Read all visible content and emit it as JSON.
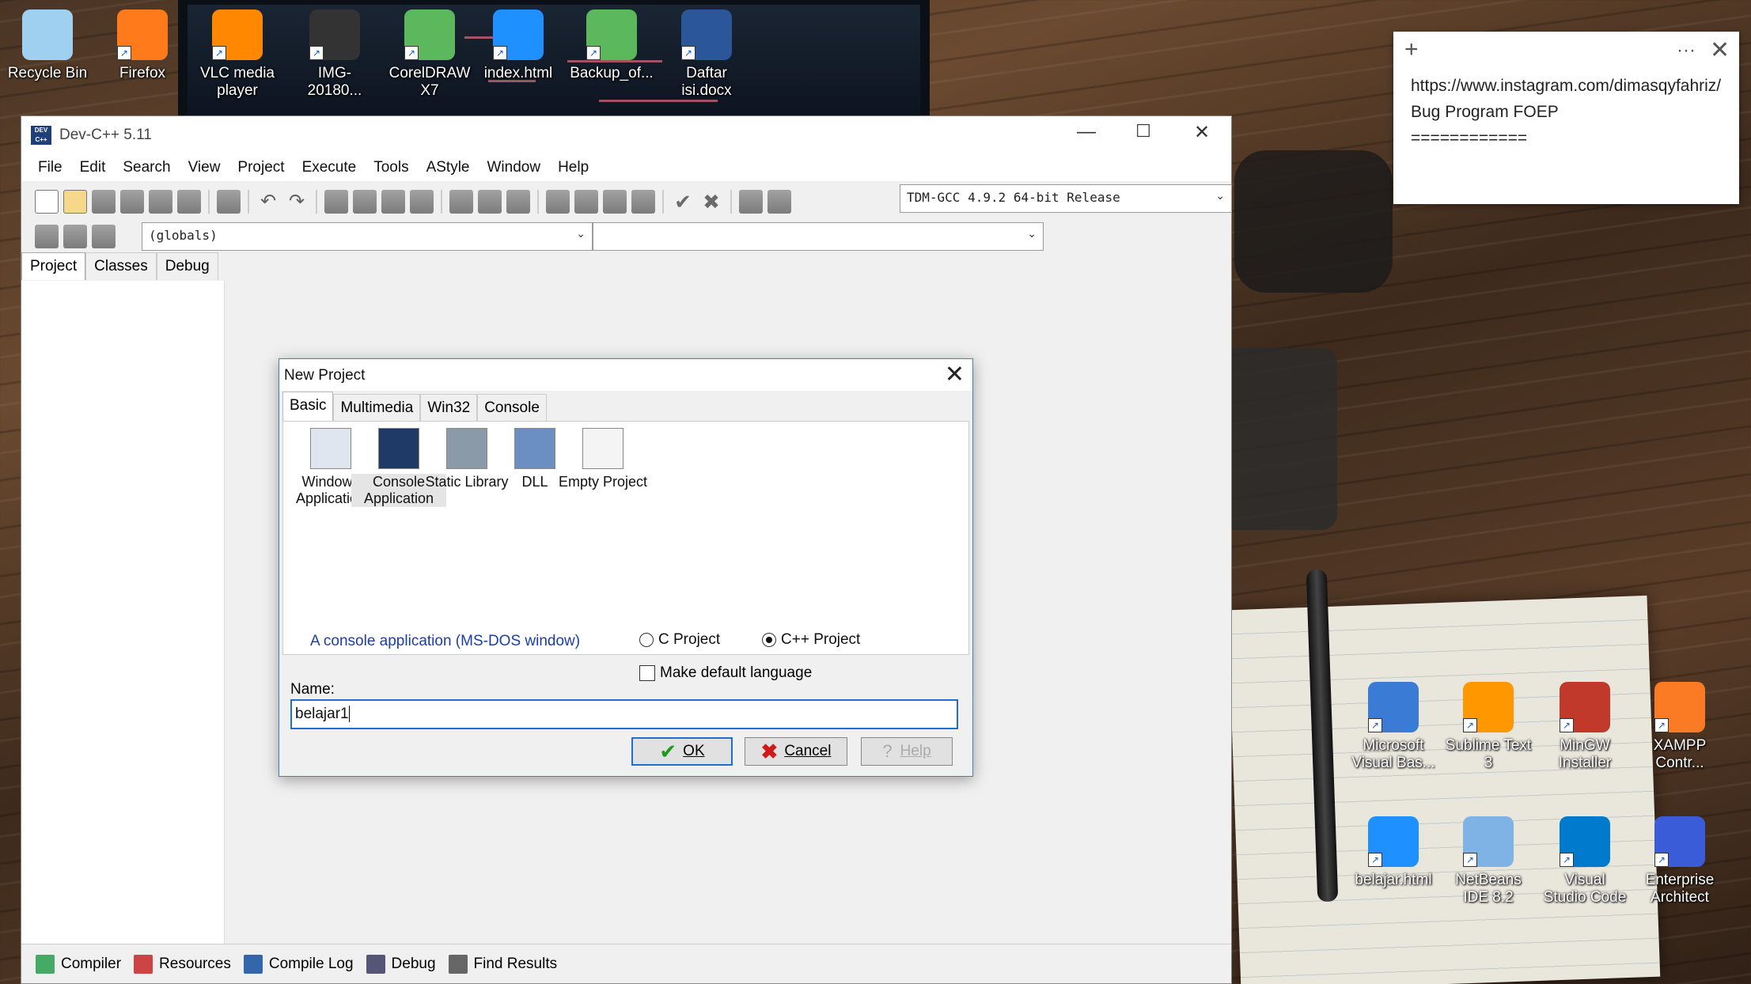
{
  "desktop": {
    "icons_top": [
      {
        "label": "Recycle Bin",
        "icon": "recycle-bin-icon",
        "color": "#9fd0ef"
      },
      {
        "label": "Firefox",
        "icon": "firefox-icon",
        "color": "#ff7a1a"
      },
      {
        "label": "VLC media player",
        "icon": "vlc-icon",
        "color": "#ff8800"
      },
      {
        "label": "IMG-20180...",
        "icon": "image-icon",
        "color": "#333333"
      },
      {
        "label": "CorelDRAW X7",
        "icon": "coreldraw-icon",
        "color": "#5cb85c"
      },
      {
        "label": "index.html",
        "icon": "internet-explorer-icon",
        "color": "#1e90ff"
      },
      {
        "label": "Backup_of...",
        "icon": "coreldraw-backup-icon",
        "color": "#5cb85c"
      },
      {
        "label": "Daftar isi.docx",
        "icon": "word-document-icon",
        "color": "#2b579a"
      }
    ],
    "icons_right": [
      {
        "label": "Microsoft Visual Bas...",
        "icon": "visual-basic-icon",
        "color": "#3a7bd5"
      },
      {
        "label": "Sublime Text 3",
        "icon": "sublime-text-icon",
        "color": "#ff9800"
      },
      {
        "label": "MinGW Installer",
        "icon": "mingw-icon",
        "color": "#c0392b"
      },
      {
        "label": "XAMPP Contr...",
        "icon": "xampp-icon",
        "color": "#fb7a24"
      },
      {
        "label": "belajar.html",
        "icon": "internet-explorer-icon",
        "color": "#1e90ff"
      },
      {
        "label": "NetBeans IDE 8.2",
        "icon": "netbeans-icon",
        "color": "#7fb2e5"
      },
      {
        "label": "Visual Studio Code",
        "icon": "vscode-icon",
        "color": "#007acc"
      },
      {
        "label": "Enterprise Architect",
        "icon": "enterprise-architect-icon",
        "color": "#3a5cd8"
      }
    ]
  },
  "sticky": {
    "text": "https://www.instagram.com/dimasqyfahriz/Bug Program FOEP",
    "underline": "============"
  },
  "window": {
    "title": "Dev-C++ 5.11",
    "logo": "DEV C++",
    "menu": [
      "File",
      "Edit",
      "Search",
      "View",
      "Project",
      "Execute",
      "Tools",
      "AStyle",
      "Window",
      "Help"
    ],
    "compiler": "TDM-GCC 4.9.2 64-bit Release",
    "globals": "(globals)",
    "left_tabs": [
      "Project",
      "Classes",
      "Debug"
    ],
    "bottom_tabs": [
      {
        "label": "Compiler",
        "icon": "compiler-icon",
        "color": "#4a6"
      },
      {
        "label": "Resources",
        "icon": "resources-icon",
        "color": "#c44"
      },
      {
        "label": "Compile Log",
        "icon": "compile-log-icon",
        "color": "#36a"
      },
      {
        "label": "Debug",
        "icon": "debug-icon",
        "color": "#557"
      },
      {
        "label": "Find Results",
        "icon": "find-results-icon",
        "color": "#666"
      }
    ]
  },
  "dialog": {
    "title": "New Project",
    "tabs": [
      "Basic",
      "Multimedia",
      "Win32",
      "Console"
    ],
    "templates": [
      {
        "label": "Windows Application",
        "icon": "windows-application-icon"
      },
      {
        "label": "Console Application",
        "icon": "console-application-icon"
      },
      {
        "label": "Static Library",
        "icon": "static-library-icon"
      },
      {
        "label": "DLL",
        "icon": "dll-icon"
      },
      {
        "label": "Empty Project",
        "icon": "empty-project-icon"
      }
    ],
    "description": "A console application (MS-DOS window)",
    "c_project": "C Project",
    "cpp_project": "C++ Project",
    "make_default": "Make default language",
    "name_label": "Name:",
    "name_value": "belajar1",
    "ok": "OK",
    "cancel": "Cancel",
    "help": "Help"
  }
}
